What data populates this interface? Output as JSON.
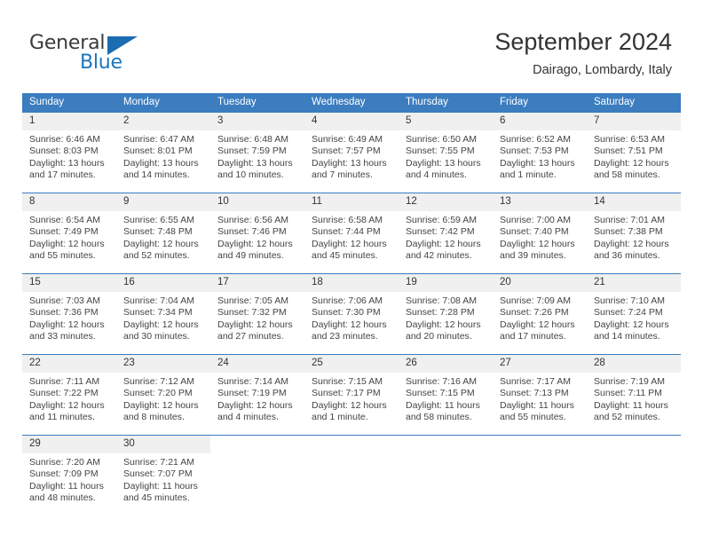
{
  "brand": {
    "name_part1": "General",
    "name_part2": "Blue",
    "accent_color": "#1b75bb"
  },
  "header": {
    "title": "September 2024",
    "subtitle": "Dairago, Lombardy, Italy"
  },
  "theme": {
    "header_row_color": "#3b7dbf",
    "daynum_bg": "#f0f0f0",
    "text_color": "#444444"
  },
  "weekday_headers": [
    "Sunday",
    "Monday",
    "Tuesday",
    "Wednesday",
    "Thursday",
    "Friday",
    "Saturday"
  ],
  "weeks": [
    [
      {
        "day": "1",
        "sunrise": "Sunrise: 6:46 AM",
        "sunset": "Sunset: 8:03 PM",
        "daylight_line1": "Daylight: 13 hours",
        "daylight_line2": "and 17 minutes."
      },
      {
        "day": "2",
        "sunrise": "Sunrise: 6:47 AM",
        "sunset": "Sunset: 8:01 PM",
        "daylight_line1": "Daylight: 13 hours",
        "daylight_line2": "and 14 minutes."
      },
      {
        "day": "3",
        "sunrise": "Sunrise: 6:48 AM",
        "sunset": "Sunset: 7:59 PM",
        "daylight_line1": "Daylight: 13 hours",
        "daylight_line2": "and 10 minutes."
      },
      {
        "day": "4",
        "sunrise": "Sunrise: 6:49 AM",
        "sunset": "Sunset: 7:57 PM",
        "daylight_line1": "Daylight: 13 hours",
        "daylight_line2": "and 7 minutes."
      },
      {
        "day": "5",
        "sunrise": "Sunrise: 6:50 AM",
        "sunset": "Sunset: 7:55 PM",
        "daylight_line1": "Daylight: 13 hours",
        "daylight_line2": "and 4 minutes."
      },
      {
        "day": "6",
        "sunrise": "Sunrise: 6:52 AM",
        "sunset": "Sunset: 7:53 PM",
        "daylight_line1": "Daylight: 13 hours",
        "daylight_line2": "and 1 minute."
      },
      {
        "day": "7",
        "sunrise": "Sunrise: 6:53 AM",
        "sunset": "Sunset: 7:51 PM",
        "daylight_line1": "Daylight: 12 hours",
        "daylight_line2": "and 58 minutes."
      }
    ],
    [
      {
        "day": "8",
        "sunrise": "Sunrise: 6:54 AM",
        "sunset": "Sunset: 7:49 PM",
        "daylight_line1": "Daylight: 12 hours",
        "daylight_line2": "and 55 minutes."
      },
      {
        "day": "9",
        "sunrise": "Sunrise: 6:55 AM",
        "sunset": "Sunset: 7:48 PM",
        "daylight_line1": "Daylight: 12 hours",
        "daylight_line2": "and 52 minutes."
      },
      {
        "day": "10",
        "sunrise": "Sunrise: 6:56 AM",
        "sunset": "Sunset: 7:46 PM",
        "daylight_line1": "Daylight: 12 hours",
        "daylight_line2": "and 49 minutes."
      },
      {
        "day": "11",
        "sunrise": "Sunrise: 6:58 AM",
        "sunset": "Sunset: 7:44 PM",
        "daylight_line1": "Daylight: 12 hours",
        "daylight_line2": "and 45 minutes."
      },
      {
        "day": "12",
        "sunrise": "Sunrise: 6:59 AM",
        "sunset": "Sunset: 7:42 PM",
        "daylight_line1": "Daylight: 12 hours",
        "daylight_line2": "and 42 minutes."
      },
      {
        "day": "13",
        "sunrise": "Sunrise: 7:00 AM",
        "sunset": "Sunset: 7:40 PM",
        "daylight_line1": "Daylight: 12 hours",
        "daylight_line2": "and 39 minutes."
      },
      {
        "day": "14",
        "sunrise": "Sunrise: 7:01 AM",
        "sunset": "Sunset: 7:38 PM",
        "daylight_line1": "Daylight: 12 hours",
        "daylight_line2": "and 36 minutes."
      }
    ],
    [
      {
        "day": "15",
        "sunrise": "Sunrise: 7:03 AM",
        "sunset": "Sunset: 7:36 PM",
        "daylight_line1": "Daylight: 12 hours",
        "daylight_line2": "and 33 minutes."
      },
      {
        "day": "16",
        "sunrise": "Sunrise: 7:04 AM",
        "sunset": "Sunset: 7:34 PM",
        "daylight_line1": "Daylight: 12 hours",
        "daylight_line2": "and 30 minutes."
      },
      {
        "day": "17",
        "sunrise": "Sunrise: 7:05 AM",
        "sunset": "Sunset: 7:32 PM",
        "daylight_line1": "Daylight: 12 hours",
        "daylight_line2": "and 27 minutes."
      },
      {
        "day": "18",
        "sunrise": "Sunrise: 7:06 AM",
        "sunset": "Sunset: 7:30 PM",
        "daylight_line1": "Daylight: 12 hours",
        "daylight_line2": "and 23 minutes."
      },
      {
        "day": "19",
        "sunrise": "Sunrise: 7:08 AM",
        "sunset": "Sunset: 7:28 PM",
        "daylight_line1": "Daylight: 12 hours",
        "daylight_line2": "and 20 minutes."
      },
      {
        "day": "20",
        "sunrise": "Sunrise: 7:09 AM",
        "sunset": "Sunset: 7:26 PM",
        "daylight_line1": "Daylight: 12 hours",
        "daylight_line2": "and 17 minutes."
      },
      {
        "day": "21",
        "sunrise": "Sunrise: 7:10 AM",
        "sunset": "Sunset: 7:24 PM",
        "daylight_line1": "Daylight: 12 hours",
        "daylight_line2": "and 14 minutes."
      }
    ],
    [
      {
        "day": "22",
        "sunrise": "Sunrise: 7:11 AM",
        "sunset": "Sunset: 7:22 PM",
        "daylight_line1": "Daylight: 12 hours",
        "daylight_line2": "and 11 minutes."
      },
      {
        "day": "23",
        "sunrise": "Sunrise: 7:12 AM",
        "sunset": "Sunset: 7:20 PM",
        "daylight_line1": "Daylight: 12 hours",
        "daylight_line2": "and 8 minutes."
      },
      {
        "day": "24",
        "sunrise": "Sunrise: 7:14 AM",
        "sunset": "Sunset: 7:19 PM",
        "daylight_line1": "Daylight: 12 hours",
        "daylight_line2": "and 4 minutes."
      },
      {
        "day": "25",
        "sunrise": "Sunrise: 7:15 AM",
        "sunset": "Sunset: 7:17 PM",
        "daylight_line1": "Daylight: 12 hours",
        "daylight_line2": "and 1 minute."
      },
      {
        "day": "26",
        "sunrise": "Sunrise: 7:16 AM",
        "sunset": "Sunset: 7:15 PM",
        "daylight_line1": "Daylight: 11 hours",
        "daylight_line2": "and 58 minutes."
      },
      {
        "day": "27",
        "sunrise": "Sunrise: 7:17 AM",
        "sunset": "Sunset: 7:13 PM",
        "daylight_line1": "Daylight: 11 hours",
        "daylight_line2": "and 55 minutes."
      },
      {
        "day": "28",
        "sunrise": "Sunrise: 7:19 AM",
        "sunset": "Sunset: 7:11 PM",
        "daylight_line1": "Daylight: 11 hours",
        "daylight_line2": "and 52 minutes."
      }
    ],
    [
      {
        "day": "29",
        "sunrise": "Sunrise: 7:20 AM",
        "sunset": "Sunset: 7:09 PM",
        "daylight_line1": "Daylight: 11 hours",
        "daylight_line2": "and 48 minutes."
      },
      {
        "day": "30",
        "sunrise": "Sunrise: 7:21 AM",
        "sunset": "Sunset: 7:07 PM",
        "daylight_line1": "Daylight: 11 hours",
        "daylight_line2": "and 45 minutes."
      },
      {
        "day": "",
        "sunrise": "",
        "sunset": "",
        "daylight_line1": "",
        "daylight_line2": ""
      },
      {
        "day": "",
        "sunrise": "",
        "sunset": "",
        "daylight_line1": "",
        "daylight_line2": ""
      },
      {
        "day": "",
        "sunrise": "",
        "sunset": "",
        "daylight_line1": "",
        "daylight_line2": ""
      },
      {
        "day": "",
        "sunrise": "",
        "sunset": "",
        "daylight_line1": "",
        "daylight_line2": ""
      },
      {
        "day": "",
        "sunrise": "",
        "sunset": "",
        "daylight_line1": "",
        "daylight_line2": ""
      }
    ]
  ]
}
